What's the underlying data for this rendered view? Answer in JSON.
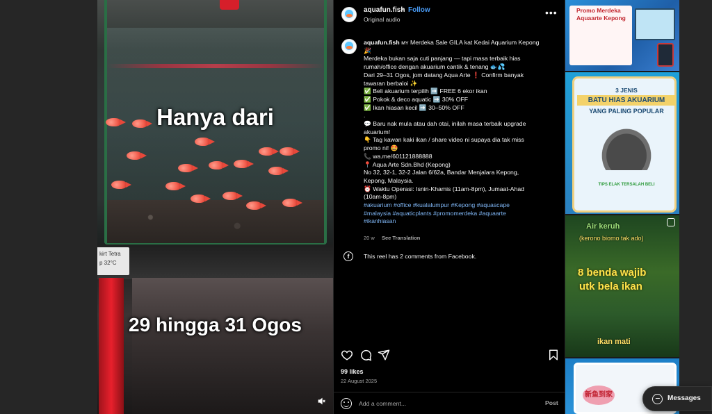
{
  "video": {
    "caption_top": "Hanya dari",
    "caption_bottom": "29 hingga 31 Ogos",
    "price_tag_line1": "kirt Tetra",
    "price_tag_line2": "p 32°C",
    "mute_icon": "speaker-muted-icon"
  },
  "header": {
    "username": "aquafun.fish",
    "separator": "•",
    "follow_label": "Follow",
    "audio_label": "Original audio",
    "more_icon": "more-horizontal-icon"
  },
  "caption": {
    "username": "aquafun.fish",
    "lines": [
      "ᴍʏ Merdeka Sale GILA kat Kedai Aquarium Kepong",
      "🎉",
      "Merdeka bukan saja cuti panjang — tapi masa terbaik hias",
      "rumah/office dengan akuarium cantik & tenang 🐟💦",
      "Dari 29–31 Ogos, jom datang Aqua Arte ❗ Confirm banyak",
      "tawaran berbaloi ✨",
      "✅ Beli akuarium terpilih ➡️ FREE 6 ekor ikan",
      "✅ Pokok & deco aquatic ➡️ 30% OFF",
      "✅ Ikan hiasan kecil ➡️ 30–50% OFF",
      ".",
      "💬 Baru nak mula atau dah otai, inilah masa terbaik upgrade",
      "akuarium!",
      "👇 Tag kawan kaki ikan / share video ni supaya dia tak miss",
      "promo ni! 🤩",
      "📞 wa.me/601121888888",
      "📍 Aqua Arte Sdn.Bhd (Kepong)",
      "No 32, 32-1, 32-2 Jalan 6/62a, Bandar Menjalara Kepong,",
      "Kepong, Malaysia.",
      "⏰ Waktu Operasi: Isnin-Khamis (11am-8pm), Jumaat-Ahad",
      "(10am-8pm)"
    ],
    "hashtag_lines": [
      [
        "#akuarium",
        "#office",
        "#kualalumpur",
        "#Kepong",
        "#aquascape"
      ],
      [
        "#malaysia",
        "#aquaticplants",
        "#promomerdeka",
        "#aquaarte"
      ],
      [
        "#ikanhiasan"
      ]
    ],
    "time_ago": "20 w",
    "see_translation": "See Translation"
  },
  "facebook_note": {
    "icon": "facebook-icon",
    "text": "This reel has 2 comments from Facebook."
  },
  "actions": {
    "like_icon": "heart-icon",
    "comment_icon": "comment-icon",
    "share_icon": "send-icon",
    "save_icon": "bookmark-icon",
    "likes_text": "99 likes",
    "date": "22 August 2025"
  },
  "comment_box": {
    "emoji_icon": "emoji-icon",
    "placeholder": "Add a comment...",
    "post_label": "Post"
  },
  "thumbnails": {
    "t1_title": "Promo Merdeka Aquaarte Kepong",
    "t2_number": "3 JENIS",
    "t2_title": "BATU HIAS AKUARIUM",
    "t2_subtitle": "YANG PALING POPULAR",
    "t2_footer": "TIPS ELAK TERSALAH BELI",
    "t3_line1": "Air keruh",
    "t3_line2": "(kerono biomo tak ado)",
    "t3_line3": "8 benda wajib",
    "t3_line4": "utk bela ikan",
    "t3_line5": "ikan mati",
    "t4_badge": "新鱼到家"
  },
  "messages": {
    "icon": "messenger-icon",
    "label": "Messages"
  },
  "colors": {
    "accent_blue": "#4a9df8",
    "hashtag_blue": "#7fb6f5",
    "background": "#000000"
  }
}
